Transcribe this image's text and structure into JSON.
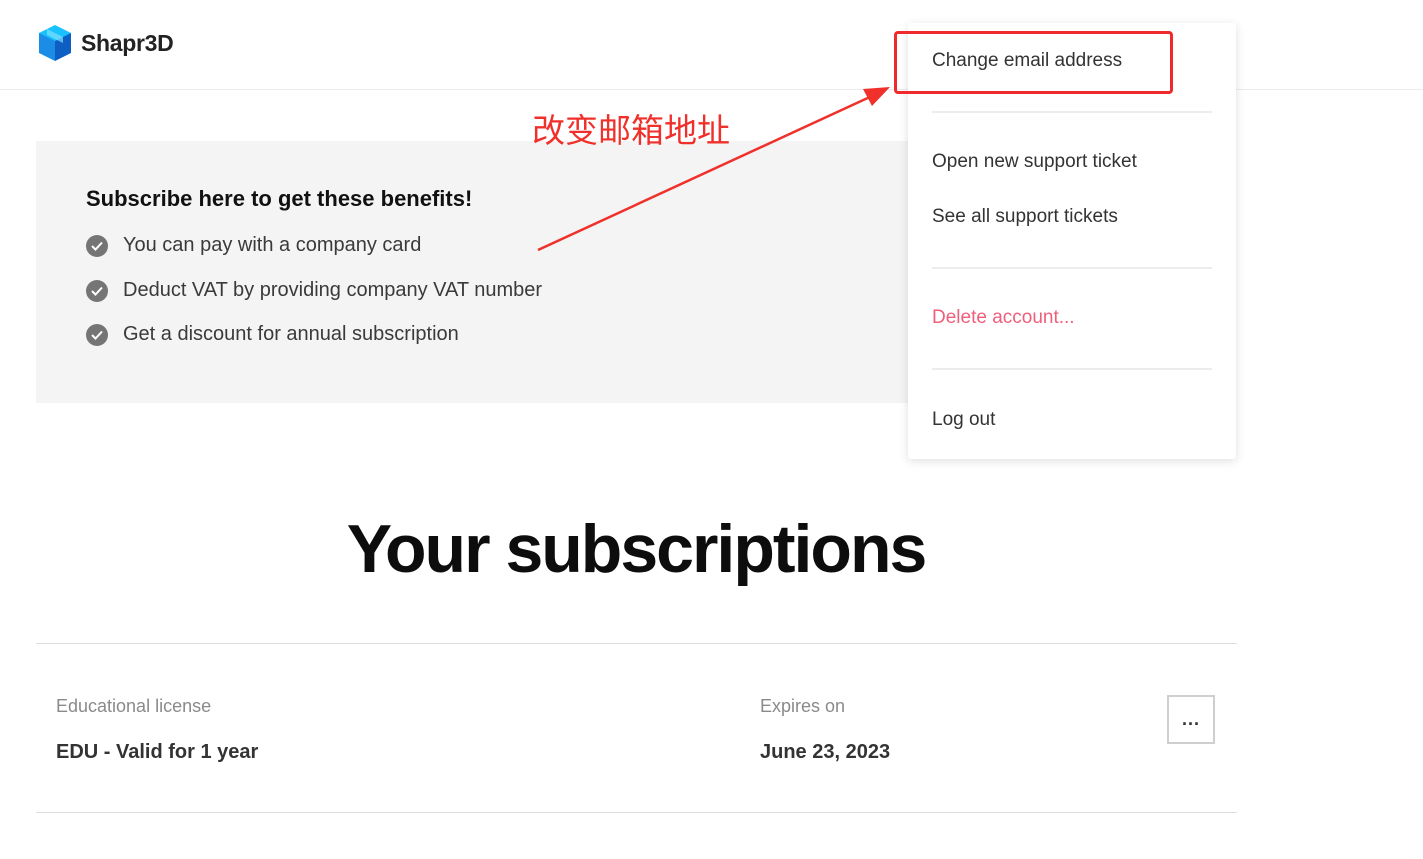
{
  "header": {
    "brand": "Shapr3D",
    "logo_icon": "shapr3d-cube-logo-icon",
    "brand_color": "#1ea7f2"
  },
  "benefits": {
    "title": "Subscribe here to get these benefits!",
    "items": [
      {
        "label": "You can pay with a company card",
        "icon": "check-circle-icon"
      },
      {
        "label": "Deduct VAT by providing company VAT number",
        "icon": "check-circle-icon"
      },
      {
        "label": "Get a discount for annual subscription",
        "icon": "check-circle-icon"
      }
    ]
  },
  "annotation": {
    "text": "改变邮箱地址",
    "color": "#f0302a"
  },
  "account_menu": {
    "items": [
      {
        "label": "Change email address"
      },
      {
        "label": "Open new support ticket"
      },
      {
        "label": "See all support tickets"
      },
      {
        "label": "Delete account...",
        "color": "#ee5f7c"
      },
      {
        "label": "Log out"
      }
    ]
  },
  "subscriptions": {
    "title": "Your subscriptions",
    "items": [
      {
        "type_label": "Educational license",
        "type_value": "EDU - Valid for 1 year",
        "expires_label": "Expires on",
        "expires_value": "June 23, 2023",
        "more_label": "..."
      }
    ]
  }
}
